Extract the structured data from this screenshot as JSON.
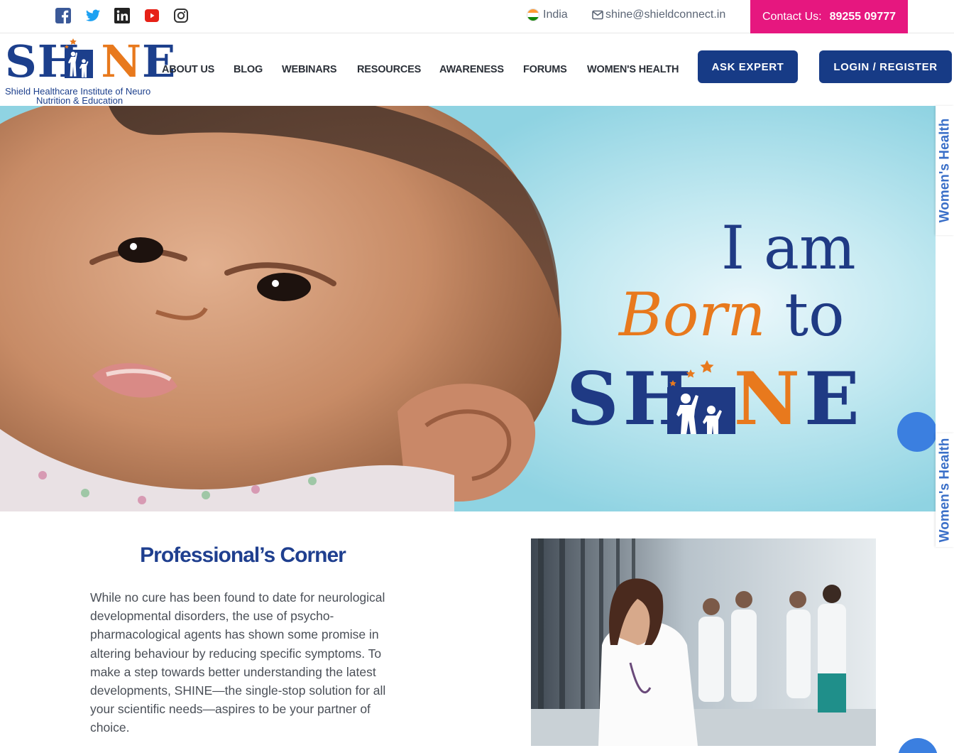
{
  "topbar": {
    "social": [
      {
        "name": "facebook-icon",
        "color": "#3b5998"
      },
      {
        "name": "twitter-icon",
        "color": "#1da1f2"
      },
      {
        "name": "linkedin-icon",
        "color": "#222222"
      },
      {
        "name": "youtube-icon",
        "color": "#e62117"
      },
      {
        "name": "instagram-icon",
        "color": "#333333"
      }
    ],
    "country": "India",
    "email": "shine@shieldconnect.in",
    "contact_label": "Contact Us:",
    "contact_phone": "89255 09777",
    "contact_bg": "#e6177f"
  },
  "logo": {
    "word_sh": "SH",
    "word_i": "I",
    "word_n": "N",
    "word_e": "E",
    "tagline_1": "Shield Healthcare Institute of Neuro",
    "tagline_2": "Nutrition & Education"
  },
  "nav": {
    "items": [
      "ABOUT US",
      "BLOG",
      "WEBINARS",
      "RESOURCES",
      "AWARENESS",
      "FORUMS",
      "WOMEN'S HEALTH"
    ],
    "ask_expert": "ASK EXPERT",
    "login": "LOGIN / REGISTER",
    "button_color": "#173b86"
  },
  "hero": {
    "line1": "I am",
    "line2_born": "Born",
    "line2_to": " to",
    "logo_sh": "SH",
    "logo_i": "I",
    "logo_n": "N",
    "logo_e": "E",
    "brand_blue": "#1f3a84",
    "brand_orange": "#e8791d"
  },
  "side_tab": "Women's Health",
  "professionals_corner": {
    "title": "Professional’s Corner",
    "body": "While no cure has been found to date for neurological developmental disorders, the use of psycho-pharmacological agents has shown some promise in altering behaviour by reducing specific symptoms. To make a step towards better understanding the latest developments, SHINE—the single-stop solution for all your scientific needs—aspires to be your partner of choice."
  }
}
